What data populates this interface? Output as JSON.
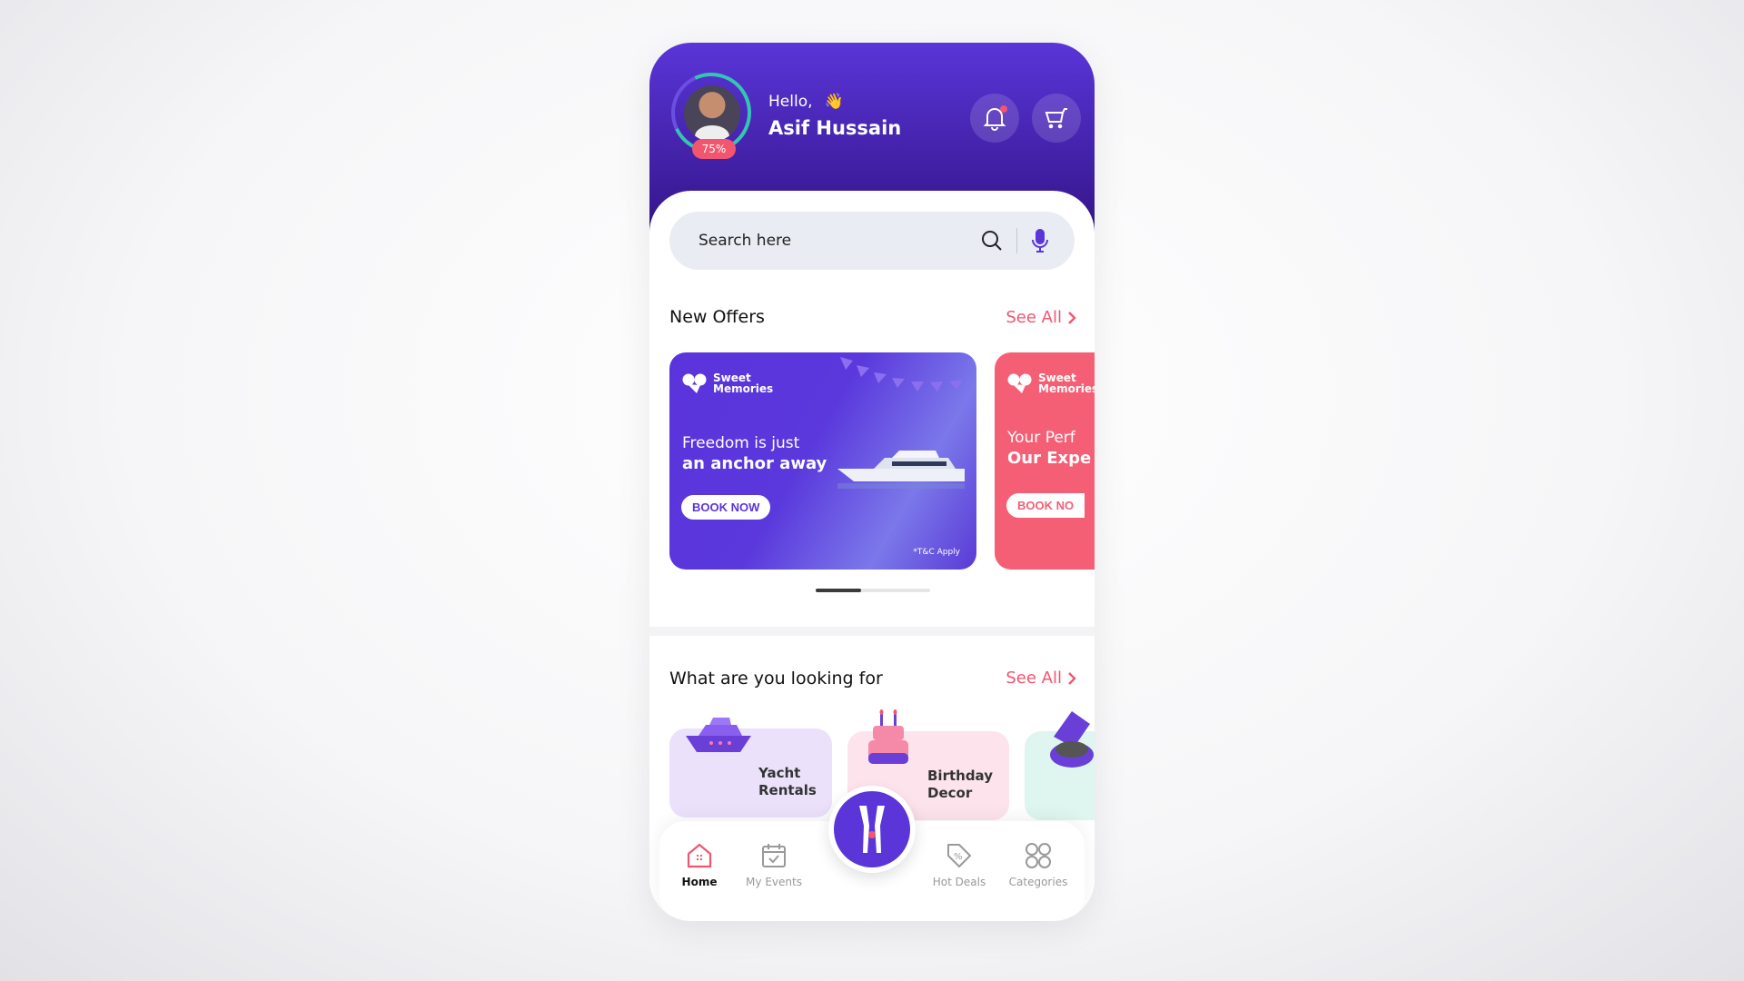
{
  "header": {
    "greeting": "Hello,",
    "wave_emoji": "👋",
    "user_name": "Asif Hussain",
    "profile_completion": "75%",
    "notification_has_badge": true
  },
  "search": {
    "placeholder": "Search here"
  },
  "offers": {
    "title": "New Offers",
    "see_all": "See All",
    "banners": [
      {
        "brand": "Sweet Memories",
        "brand_line1": "Sweet",
        "brand_line2": "Memories",
        "line1": "Freedom is just",
        "line2": "an anchor away",
        "button": "BOOK NOW",
        "note": "*T&C Apply",
        "color": "#5b33dc"
      },
      {
        "brand": "Sweet Memories",
        "brand_line1": "Sweet",
        "brand_line2": "Memories",
        "line1": "Your Perf",
        "line2": "Our Expe",
        "button": "BOOK NO",
        "color": "#f55f75"
      }
    ],
    "active_page": 1,
    "pages": 2
  },
  "categories": {
    "title": "What are you looking for",
    "see_all": "See All",
    "items": [
      {
        "line1": "Yacht",
        "line2": "Rentals",
        "color": "#ebe1fb"
      },
      {
        "line1": "Birthday",
        "line2": "Decor",
        "color": "#fde4ec"
      },
      {
        "line1": "",
        "line2": "",
        "color": "#dff5f0"
      }
    ]
  },
  "nav": {
    "items": [
      {
        "label": "Home",
        "icon": "home-icon",
        "active": true
      },
      {
        "label": "My Events",
        "icon": "calendar-icon"
      },
      {
        "label": "Hot Deals",
        "icon": "discount-tag-icon"
      },
      {
        "label": "Categories",
        "icon": "grid-icon"
      }
    ],
    "center_icon": "champagne-glass-icon"
  },
  "colors": {
    "primary": "#5b35d8",
    "accent": "#f2566f",
    "ring": "#34c6b0"
  }
}
